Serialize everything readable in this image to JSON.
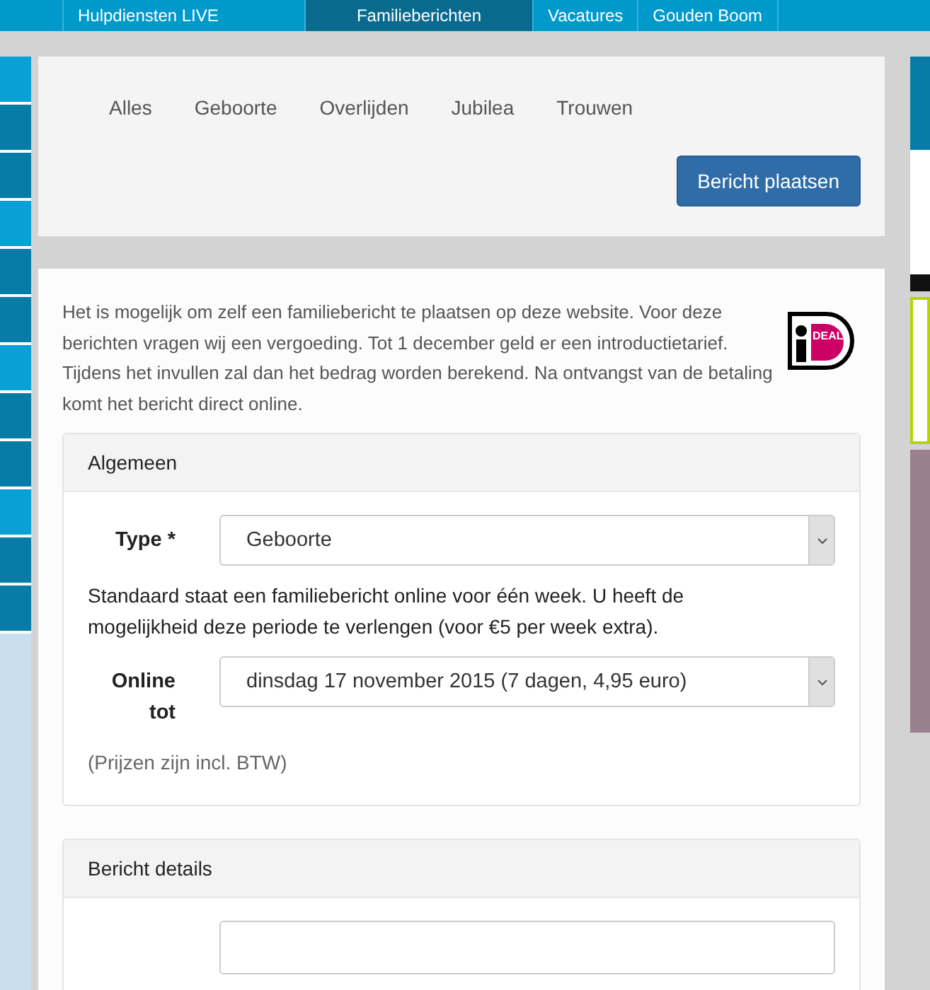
{
  "top_nav": [
    {
      "label": "Hulpdiensten LIVE",
      "selected": false
    },
    {
      "label": "Familieberichten",
      "selected": true
    },
    {
      "label": "Vacatures",
      "selected": false
    },
    {
      "label": "Gouden Boom",
      "selected": false
    }
  ],
  "filter": {
    "tabs": [
      {
        "label": "Alles"
      },
      {
        "label": "Geboorte"
      },
      {
        "label": "Overlijden"
      },
      {
        "label": "Jubilea"
      },
      {
        "label": "Trouwen"
      }
    ],
    "button": "Bericht plaatsen"
  },
  "intro": "Het is mogelijk om zelf een familiebericht te plaatsen op deze website. Voor deze berichten vragen wij een vergoeding. Tot 1 december geld er een introductietarief. Tijdens het invullen zal dan het bedrag worden berekend. Na ontvangst van de betaling komt het bericht direct online.",
  "payment_logo": {
    "text": "DEAL"
  },
  "panels": [
    {
      "title": "Algemeen",
      "items": [
        {
          "kind": "select",
          "label": "Type *",
          "value": "Geboorte"
        },
        {
          "kind": "text",
          "text": "Standaard staat een familiebericht online voor één week. U heeft de mogelijkheid deze periode te verlengen (voor €5 per week extra)."
        },
        {
          "kind": "select",
          "label": "Online tot",
          "value": "dinsdag 17 november 2015 (7 dagen, 4,95 euro)"
        },
        {
          "kind": "note",
          "text": "(Prijzen zijn incl. BTW)"
        }
      ]
    },
    {
      "title": "Bericht details",
      "items": [
        {
          "kind": "input"
        }
      ]
    }
  ]
}
